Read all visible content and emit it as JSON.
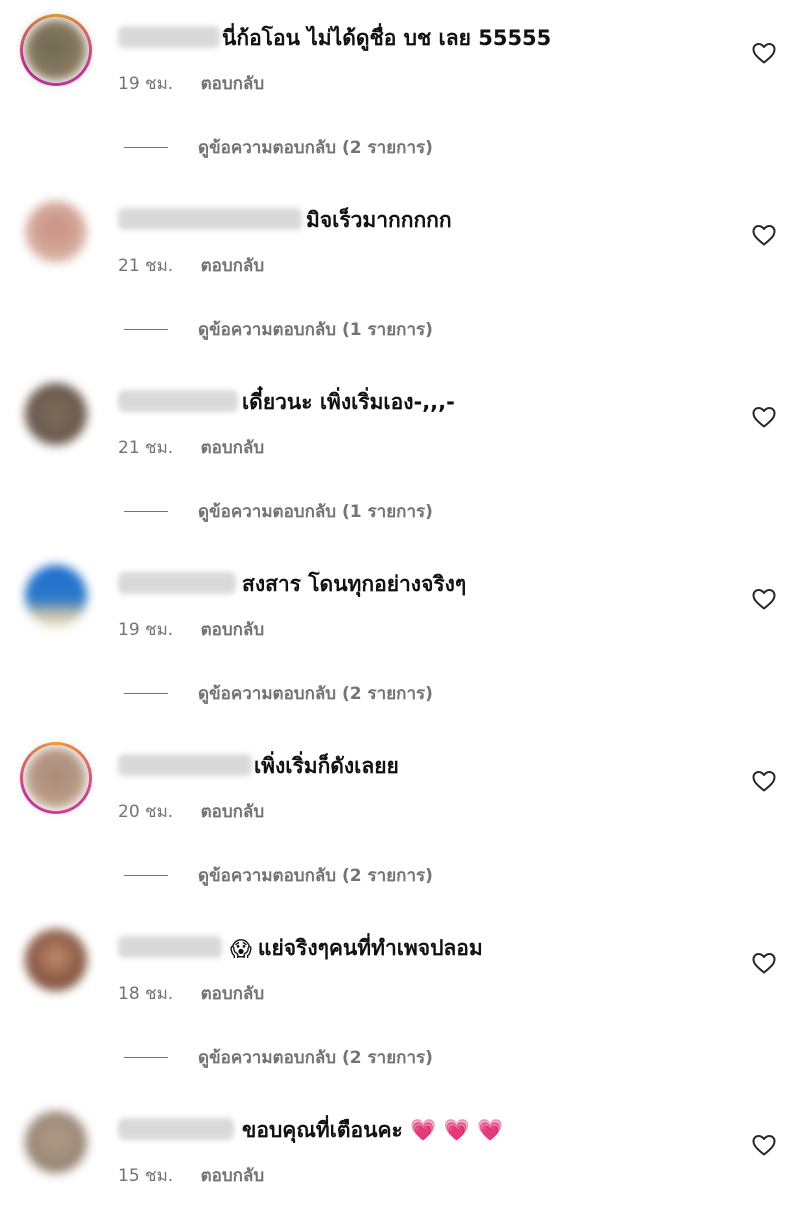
{
  "comments": [
    {
      "text": "นี่ก้อโอน ไม่ได้ดูชื่อ บช เลย 55555",
      "time": "19 ชม.",
      "reply": "ตอบกลับ",
      "view_replies": "ดูข้อความตอบกลับ (2 รายการ)",
      "avatar_color": "#8a7a60",
      "ring": "magenta-orange"
    },
    {
      "text": "มิจเร็วมากกกกก",
      "time": "21 ชม.",
      "reply": "ตอบกลับ",
      "view_replies": "ดูข้อความตอบกลับ (1 รายการ)",
      "avatar_color": "#d4a99a",
      "ring": "none"
    },
    {
      "text": "เดี๋ยวนะ เพิ่งเริ่มเอง-,,,-",
      "time": "21 ชม.",
      "reply": "ตอบกลับ",
      "view_replies": "ดูข้อความตอบกลับ (1 รายการ)",
      "avatar_color": "#6e5d50",
      "ring": "none"
    },
    {
      "text": "สงสาร โดนทุกอย่างจริงๆ",
      "time": "19 ชม.",
      "reply": "ตอบกลับ",
      "view_replies": "ดูข้อความตอบกลับ (2 รายการ)",
      "avatar_color": "#2a78c8",
      "ring": "none"
    },
    {
      "text": "เพิ่งเริ่มก็ดังเลยย",
      "time": "20 ชม.",
      "reply": "ตอบกลับ",
      "view_replies": "ดูข้อความตอบกลับ (2 รายการ)",
      "avatar_color": "#b89a86",
      "ring": "magenta-orange"
    },
    {
      "emoji": "😱",
      "text": "แย่จริงๆคนที่ทำเพจปลอม",
      "time": "18 ชม.",
      "reply": "ตอบกลับ",
      "view_replies": "ดูข้อความตอบกลับ (2 รายการ)",
      "avatar_color": "#8a5a44",
      "ring": "none"
    },
    {
      "text": "ขอบคุณที่เตือนคะ 💗 💗 💗",
      "time": "15 ชม.",
      "reply": "ตอบกลับ",
      "avatar_color": "#9c8a78",
      "ring": "none"
    }
  ],
  "colors": {
    "text": "#111111",
    "meta": "#737373",
    "heart_outline": "#262626"
  },
  "icons": {
    "like": "heart-outline-icon"
  }
}
